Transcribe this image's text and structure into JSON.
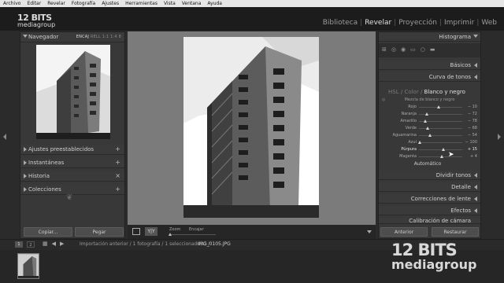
{
  "menu": [
    "Archivo",
    "Editar",
    "Revelar",
    "Fotografía",
    "Ajustes",
    "Herramientas",
    "Vista",
    "Ventana",
    "Ayuda"
  ],
  "logo": {
    "line1": "12 BITS",
    "line2": "mediagroup"
  },
  "modules": [
    "Biblioteca",
    "Revelar",
    "Proyección",
    "Imprimir",
    "Web"
  ],
  "module_separator": "|",
  "active_module": "Revelar",
  "left_panel": {
    "navigator": {
      "title": "Navegador",
      "modes": [
        "ENCAJ",
        "RELL",
        "1:1",
        "1:4",
        "8"
      ]
    },
    "sections": [
      {
        "label": "Ajustes preestablecidos",
        "action": "+"
      },
      {
        "label": "Instantáneas",
        "action": "+"
      },
      {
        "label": "Historia",
        "action": "×"
      },
      {
        "label": "Colecciones",
        "action": "+"
      }
    ],
    "ornament": "❦",
    "copy_button": "Copiar...",
    "paste_button": "Pegar"
  },
  "toolbar": {
    "zoom_label": "Zoom",
    "fit_label": "Encajar",
    "view_label": "Y|Y",
    "zoom_level": 0.0
  },
  "right_panel": {
    "histogram_title": "Histograma",
    "basic": "Básicos",
    "tone_curve": "Curva de tonos",
    "hsl_tabs": [
      "HSL",
      "Color",
      "Blanco y negro"
    ],
    "tab_separator": "/",
    "active_tab": "Blanco y negro",
    "mix_title": "Mezcla de blanco y negro",
    "mix_target": "◎",
    "sliders": [
      {
        "label": "Rojo",
        "value": "− 10",
        "pos": 0.45
      },
      {
        "label": "Naranja",
        "value": "− 72",
        "pos": 0.18
      },
      {
        "label": "Amarillo",
        "value": "− 78",
        "pos": 0.15
      },
      {
        "label": "Verde",
        "value": "− 68",
        "pos": 0.2
      },
      {
        "label": "Aguamarina",
        "value": "− 54",
        "pos": 0.25
      },
      {
        "label": "Azul",
        "value": "− 100",
        "pos": 0.02
      },
      {
        "label": "Púrpura",
        "value": "+ 15",
        "pos": 0.56
      },
      {
        "label": "Magenta",
        "value": "+ 4",
        "pos": 0.52
      }
    ],
    "auto_button": "Automático",
    "other_panels": [
      "Dividir tonos",
      "Detalle",
      "Correcciones de lente",
      "Efectos",
      "Calibración de cámara"
    ],
    "prev_button": "Anterior",
    "reset_button": "Restaurar"
  },
  "filmstrip": {
    "page1": "1",
    "page2": "2",
    "breadcrumb": "Importación anterior / 1 fotografía / 1 seleccionado(s) /",
    "filename": "IMG_0105.JPG"
  },
  "watermark": {
    "line1": "12 BITS",
    "line2": "mediagroup"
  }
}
